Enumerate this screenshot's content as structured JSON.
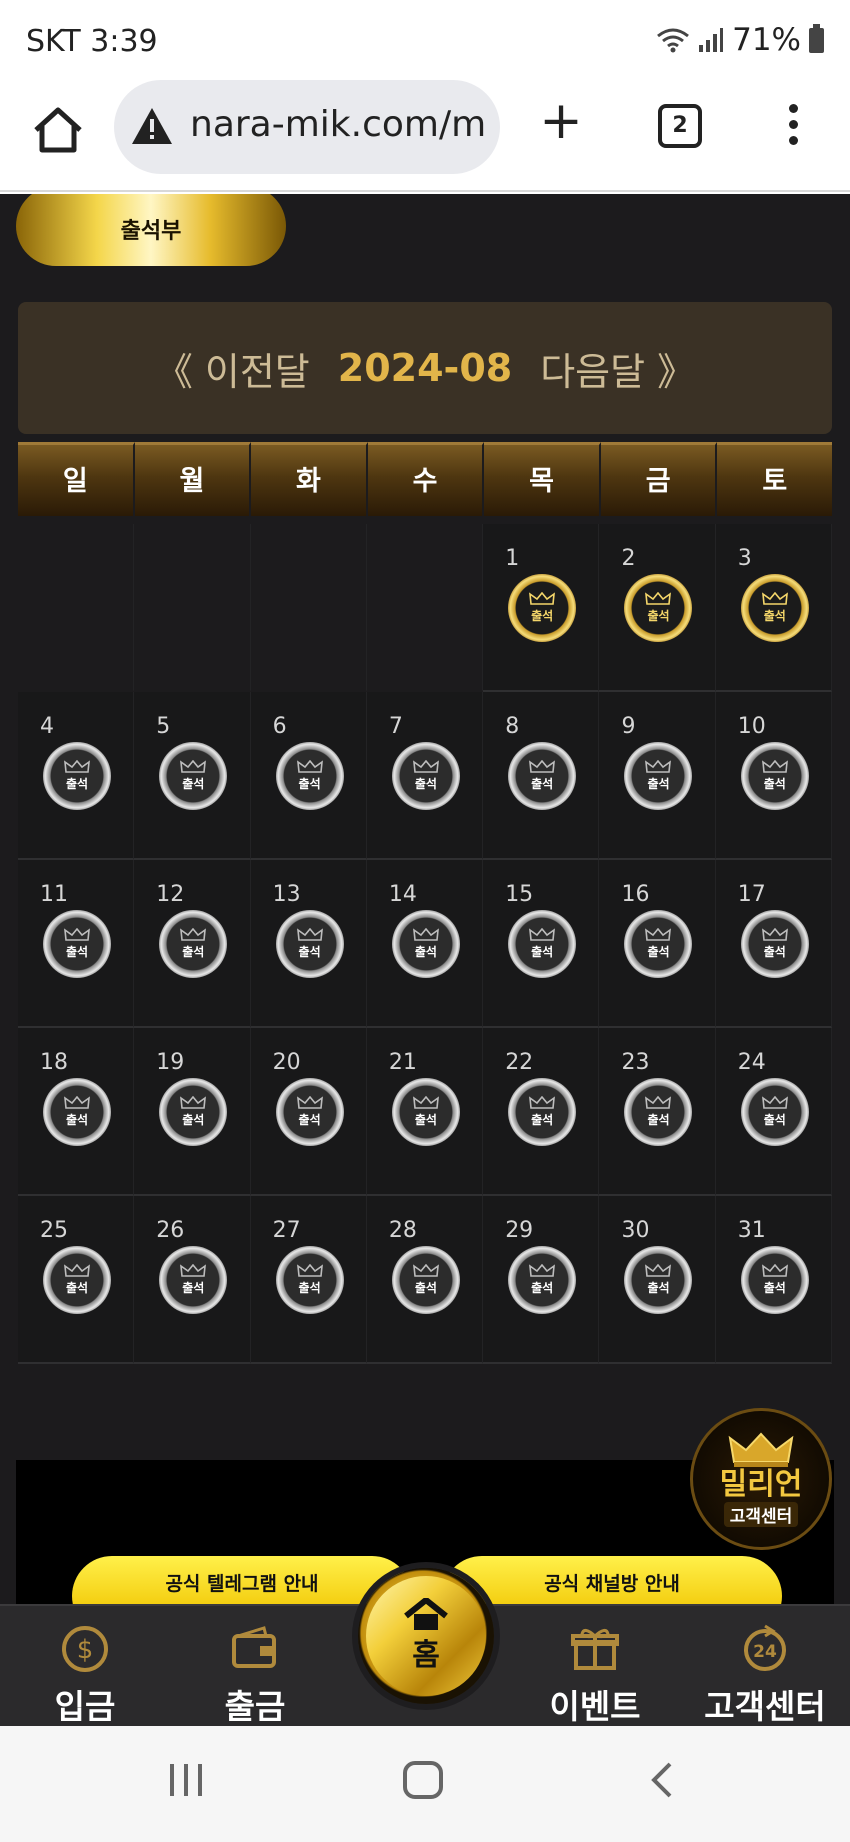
{
  "status_bar": {
    "time": "SKT 3:39",
    "battery": "71%"
  },
  "browser": {
    "url": "nara-mik.com/m",
    "tab_count": "2"
  },
  "attendance": {
    "tab_label": "출석부",
    "nav": {
      "prev": "《 이전달",
      "month": "2024-08",
      "next": "다음달 》"
    },
    "weekdays": [
      "일",
      "월",
      "화",
      "수",
      "목",
      "금",
      "토"
    ],
    "stamp_label": "출석",
    "leading_blank_days": 4,
    "attended_days": [
      1,
      2,
      3
    ],
    "days": [
      "1",
      "2",
      "3",
      "4",
      "5",
      "6",
      "7",
      "8",
      "9",
      "10",
      "11",
      "12",
      "13",
      "14",
      "15",
      "16",
      "17",
      "18",
      "19",
      "20",
      "21",
      "22",
      "23",
      "24",
      "25",
      "26",
      "27",
      "28",
      "29",
      "30",
      "31"
    ]
  },
  "promo": {
    "telegram": "공식 텔레그램 안내",
    "channel": "공식 채널방 안내"
  },
  "support_badge": {
    "title": "밀리언",
    "subtitle": "고객센터"
  },
  "bottom_nav": {
    "deposit": "입금",
    "withdraw": "출금",
    "home": "홈",
    "event": "이벤트",
    "support": "고객센터"
  },
  "colors": {
    "gold": "#e2b54a",
    "background": "#1c1b1d",
    "promo_yellow": "#f4cf12"
  }
}
